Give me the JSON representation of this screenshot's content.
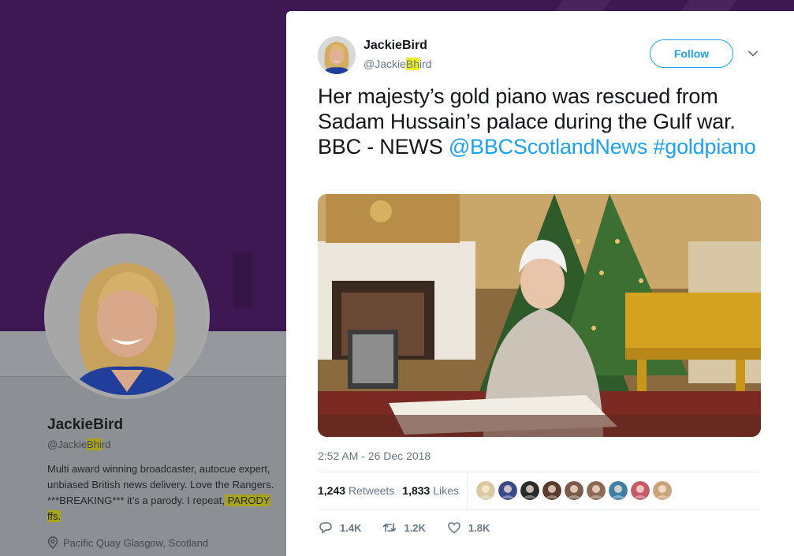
{
  "profile": {
    "name": "JackieBird",
    "handle_prefix": "@Jackie",
    "handle_highlight": "Bhi",
    "handle_suffix": "rd",
    "bio_main": "Multi award winning broadcaster, autocue expert, unbiased British news delivery. Love the Rangers. ***BREAKING*** it’s a parody. I repeat,",
    "bio_highlight": " PARODY ffs. ",
    "location": "Pacific Quay Glasgow, Scotland"
  },
  "tweet": {
    "author_name": "JackieBird",
    "handle_prefix": "@Jackie",
    "handle_highlight": "Bh",
    "handle_suffix": "ird",
    "follow_label": "Follow",
    "text_main": "Her majesty’s gold piano was rescued from Sadam Hussain’s palace during the Gulf war. BBC - NEWS ",
    "mention": "@BBCScotlandNews",
    "hashtag": "#goldpiano",
    "timestamp": "2:52 AM - 26 Dec 2018",
    "retweets_count": "1,243",
    "retweets_label": "Retweets",
    "likes_count": "1,833",
    "likes_label": "Likes",
    "reply_count": "1.4K",
    "retweet_count_short": "1.2K",
    "like_count_short": "1.8K"
  },
  "likers": [
    {
      "color": "#d9c9a3"
    },
    {
      "color": "#3b4a8a"
    },
    {
      "color": "#2b2b2b"
    },
    {
      "color": "#5a3a2a"
    },
    {
      "color": "#7a5a4a"
    },
    {
      "color": "#8c6a55"
    },
    {
      "color": "#3f7fa6"
    },
    {
      "color": "#c45a6a"
    },
    {
      "color": "#c9a37a"
    }
  ],
  "colors": {
    "accent": "#1da1f2",
    "banner": "#3d1852",
    "highlight": "#ecef1f"
  },
  "icons": [
    "caret-down-icon",
    "location-pin-icon",
    "reply-icon",
    "retweet-icon",
    "heart-icon"
  ]
}
